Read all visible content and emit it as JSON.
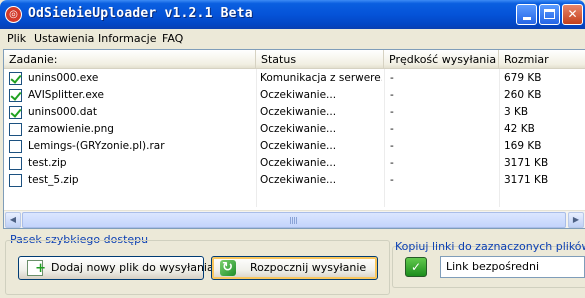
{
  "window": {
    "title": "OdSiebieUploader v1.2.1 Beta",
    "icon": "app-logo-icon"
  },
  "menu": [
    "Plik",
    "Ustawienia",
    "Informacje",
    "FAQ"
  ],
  "table": {
    "columns": [
      "Zadanie:",
      "Status",
      "Prędkość wysyłania",
      "Rozmiar"
    ],
    "rows": [
      {
        "checked": true,
        "name": "unins000.exe",
        "status": "Komunikacja z serwere...",
        "speed": "-",
        "size": "679 KB"
      },
      {
        "checked": true,
        "name": "AVISplitter.exe",
        "status": "Oczekiwanie...",
        "speed": "-",
        "size": "260 KB"
      },
      {
        "checked": true,
        "name": "unins000.dat",
        "status": "Oczekiwanie...",
        "speed": "-",
        "size": "3 KB"
      },
      {
        "checked": false,
        "name": "zamowienie.png",
        "status": "Oczekiwanie...",
        "speed": "-",
        "size": "42 KB"
      },
      {
        "checked": false,
        "name": "Lemings-(GRYzonie.pl).rar",
        "status": "Oczekiwanie...",
        "speed": "-",
        "size": "169 KB"
      },
      {
        "checked": false,
        "name": "test.zip",
        "status": "Oczekiwanie...",
        "speed": "-",
        "size": "3171 KB"
      },
      {
        "checked": false,
        "name": "test_5.zip",
        "status": "Oczekiwanie...",
        "speed": "-",
        "size": "3171 KB"
      }
    ]
  },
  "quickbar": {
    "label": "Pasek szybkiego dostępu",
    "add_button": "Dodaj nowy plik do wysyłania",
    "start_button": "Rozpocznij wysyłanie"
  },
  "copy_links": {
    "label": "Kopiuj linki do zaznaczonych plików",
    "ok_icon": "check-icon",
    "selected": "Link bezpośredni"
  },
  "colors": {
    "titlebar": "#0553d8",
    "group_label": "#0b3fb3",
    "check_green": "#21a121"
  }
}
